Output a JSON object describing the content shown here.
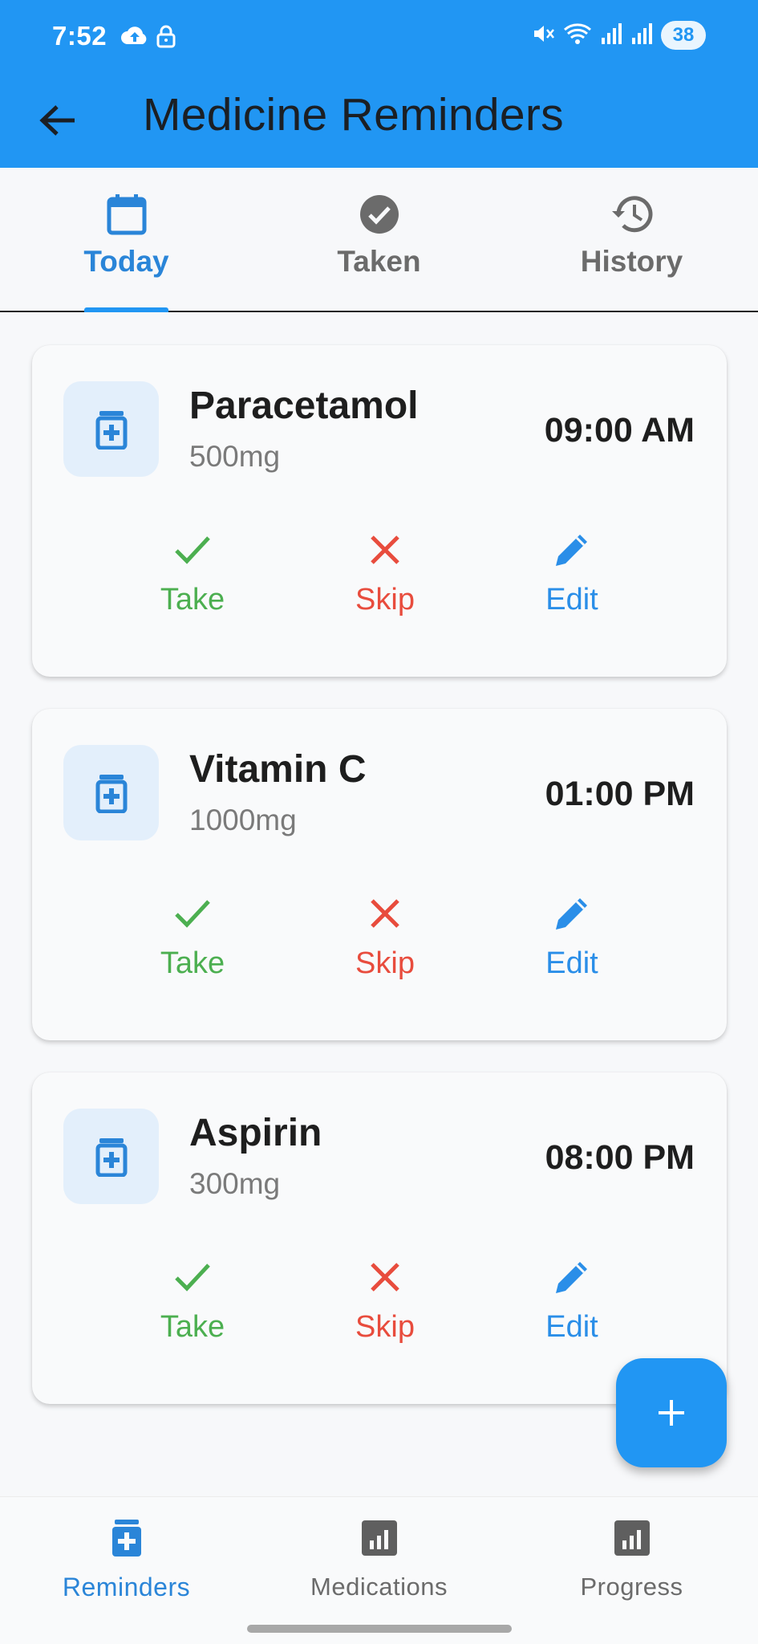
{
  "status_bar": {
    "time": "7:52",
    "battery": "38"
  },
  "header": {
    "title": "Medicine Reminders",
    "background_color": "#2196f3"
  },
  "tabs": [
    {
      "label": "Today",
      "icon": "calendar-icon",
      "active": true
    },
    {
      "label": "Taken",
      "icon": "check-circle-icon",
      "active": false
    },
    {
      "label": "History",
      "icon": "history-icon",
      "active": false
    }
  ],
  "reminders": [
    {
      "name": "Paracetamol",
      "dose": "500mg",
      "time": "09:00 AM"
    },
    {
      "name": "Vitamin C",
      "dose": "1000mg",
      "time": "01:00 PM"
    },
    {
      "name": "Aspirin",
      "dose": "300mg",
      "time": "08:00 PM"
    }
  ],
  "actions": {
    "take": "Take",
    "skip": "Skip",
    "edit": "Edit"
  },
  "colors": {
    "accent": "#2196f3",
    "take": "#4caf50",
    "skip": "#e84c3d",
    "edit": "#2a8ee8"
  },
  "bottom_nav": [
    {
      "label": "Reminders",
      "icon": "medicine-icon",
      "active": true
    },
    {
      "label": "Medications",
      "icon": "bar-chart-icon",
      "active": false
    },
    {
      "label": "Progress",
      "icon": "bar-chart-icon",
      "active": false
    }
  ]
}
